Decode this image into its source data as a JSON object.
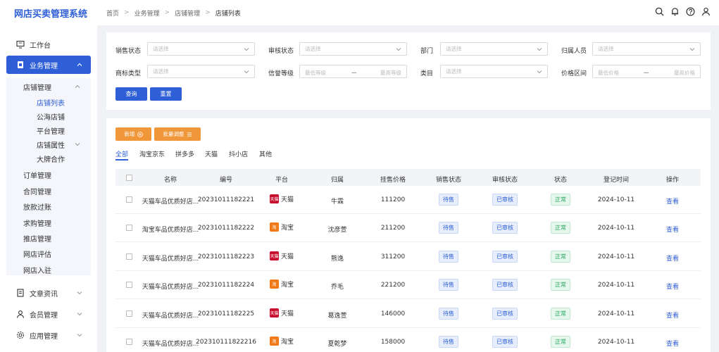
{
  "app": {
    "title": "网店买卖管理系统"
  },
  "breadcrumb": [
    "首页",
    "业务管理",
    "店铺管理",
    "店铺列表"
  ],
  "sidebar": {
    "top_items": [
      {
        "label": "工作台",
        "icon": "monitor-icon"
      },
      {
        "label": "业务管理",
        "icon": "briefcase-icon",
        "active": true
      }
    ],
    "business_sub": [
      {
        "label": "店铺管理",
        "level": 1,
        "expanded": true
      },
      {
        "label": "店铺列表",
        "level": 2,
        "active": true
      },
      {
        "label": "公海店铺",
        "level": 2
      },
      {
        "label": "平台管理",
        "level": 2
      },
      {
        "label": "店铺属性",
        "level": 2,
        "has_children": true
      },
      {
        "label": "大牌合作",
        "level": 2
      },
      {
        "label": "订单管理",
        "level": 1
      },
      {
        "label": "合同管理",
        "level": 1
      },
      {
        "label": "放款过账",
        "level": 1
      },
      {
        "label": "求购管理",
        "level": 1
      },
      {
        "label": "推店管理",
        "level": 1
      },
      {
        "label": "网店评估",
        "level": 1
      },
      {
        "label": "网店入驻",
        "level": 1
      }
    ],
    "bottom_items": [
      {
        "label": "文章资讯",
        "icon": "document-icon"
      },
      {
        "label": "会员管理",
        "icon": "user-icon"
      },
      {
        "label": "应用管理",
        "icon": "gear-icon"
      }
    ]
  },
  "filters": {
    "sales_status": {
      "label": "销售状态",
      "placeholder": "请选择"
    },
    "audit_status": {
      "label": "审核状态",
      "placeholder": "请选择"
    },
    "department": {
      "label": "部门",
      "placeholder": "请选择"
    },
    "owner": {
      "label": "归属人员",
      "placeholder": "请选择"
    },
    "trademark_type": {
      "label": "商标类型",
      "placeholder": "请选择"
    },
    "credit_level": {
      "label": "信誉等级",
      "min": "最低等级",
      "sep": "一",
      "max": "最高等级"
    },
    "category": {
      "label": "类目",
      "placeholder": "请选择"
    },
    "price_range": {
      "label": "价格区间",
      "min": "最低价格",
      "sep": "一",
      "max": "最高价格"
    },
    "query_btn": "查询",
    "reset_btn": "重置"
  },
  "actions": {
    "add_btn": "新增",
    "batch_btn": "批量调整"
  },
  "tabs": [
    "全部",
    "淘宝京东",
    "拼多多",
    "天猫",
    "抖小店",
    "其他"
  ],
  "table": {
    "headers": [
      "名称",
      "编号",
      "平台",
      "归属",
      "挂售价格",
      "销售状态",
      "审核状态",
      "状态",
      "登记时间",
      "操作"
    ],
    "rows": [
      {
        "name": "天猫车品优质好店...",
        "code": "20231011182221",
        "platform": "天猫",
        "platform_logo": "tmall",
        "logo_text": "天猫",
        "owner": "牛霖",
        "price": "111200",
        "sales": "待售",
        "audit": "已审核",
        "status": "正常",
        "date": "2024-10-11",
        "op": "查看"
      },
      {
        "name": "淘宝车品优质好店...",
        "code": "20231011182222",
        "platform": "淘宝",
        "platform_logo": "taobao",
        "logo_text": "淘",
        "owner": "沈彦萱",
        "price": "211200",
        "sales": "待售",
        "audit": "已审核",
        "status": "正常",
        "date": "2024-10-11",
        "op": "查看"
      },
      {
        "name": "天猫车品优质好店...",
        "code": "20231011182223",
        "platform": "天猫",
        "platform_logo": "tmall",
        "logo_text": "天猫",
        "owner": "熊逸",
        "price": "311200",
        "sales": "待售",
        "audit": "已审核",
        "status": "正常",
        "date": "2024-10-11",
        "op": "查看"
      },
      {
        "name": "天猫车品优质好店...",
        "code": "20231011182224",
        "platform": "淘宝",
        "platform_logo": "taobao",
        "logo_text": "淘",
        "owner": "乔毛",
        "price": "221200",
        "sales": "待售",
        "audit": "已审核",
        "status": "正常",
        "date": "2024-10-11",
        "op": "查看"
      },
      {
        "name": "天猫车品优质好店...",
        "code": "20231011182225",
        "platform": "天猫",
        "platform_logo": "tmall",
        "logo_text": "天猫",
        "owner": "葛逸萱",
        "price": "146000",
        "sales": "待售",
        "audit": "已审核",
        "status": "正常",
        "date": "2024-10-11",
        "op": "查看"
      },
      {
        "name": "天猫车品优质好店...",
        "code": "202310111822216",
        "platform": "淘宝",
        "platform_logo": "taobao",
        "logo_text": "淘",
        "owner": "夏乾梦",
        "price": "158000",
        "sales": "待售",
        "audit": "已审核",
        "status": "正常",
        "date": "2024-10-11",
        "op": "查看"
      }
    ]
  },
  "colors": {
    "primary": "#2e5fd6",
    "orange": "#f0973a",
    "green": "#26a65b"
  }
}
